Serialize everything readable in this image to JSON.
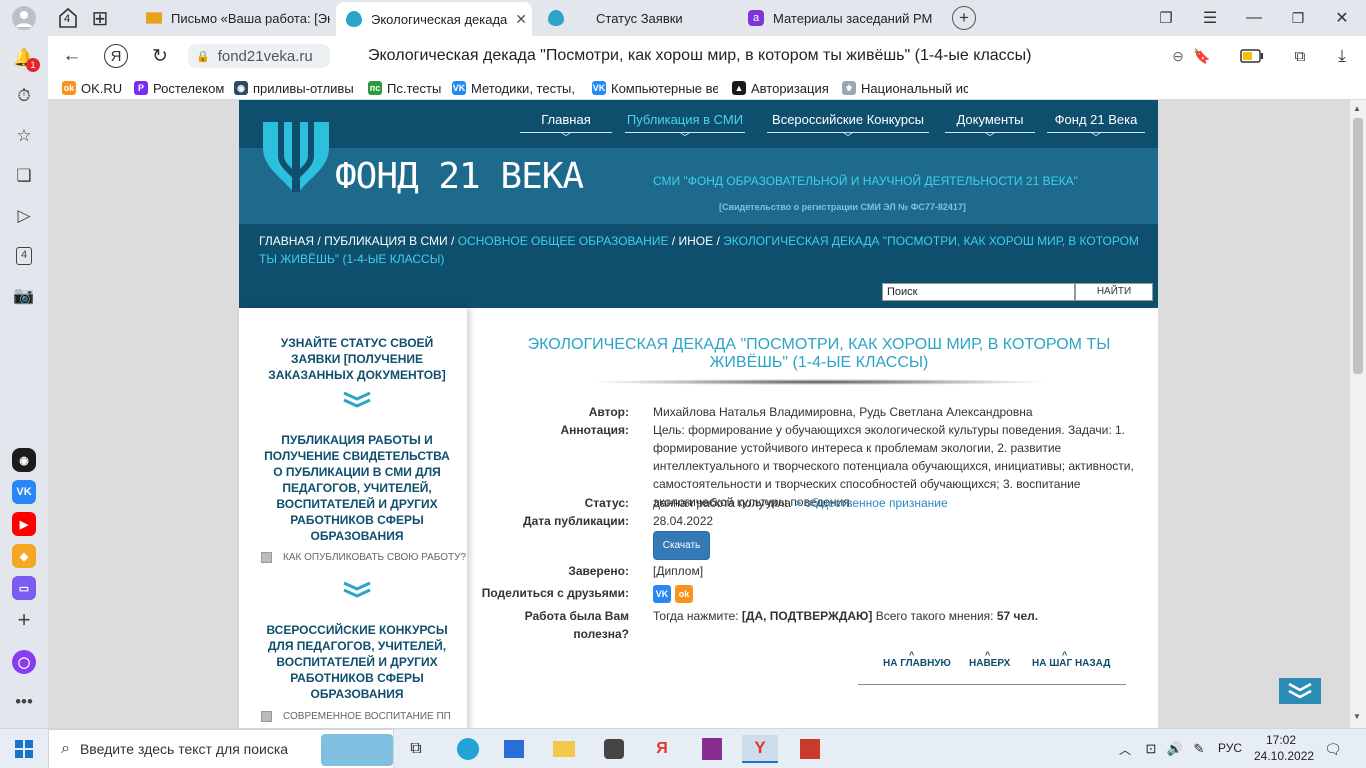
{
  "browser": {
    "tabs": [
      {
        "title": "Письмо «Ваша работа: [Эк"
      },
      {
        "title": "Экологическая декада",
        "active": true
      },
      {
        "title": "Статус Заявки"
      },
      {
        "title": "Материалы заседаний РМ"
      }
    ],
    "tab_counter": "4",
    "address_domain": "fond21veka.ru",
    "page_title": "Экологическая декада \"Посмотри, как хорош мир, в котором ты живёшь\" (1-4-ые классы)",
    "notification_badge": "1",
    "sidebar_counter": "4",
    "bookmarks": [
      "OK.RU",
      "Ростелеком",
      "приливы-отливы",
      "Пс.тесты",
      "Методики, тесты,",
      "Компьютерные ве",
      "Авторизация",
      "Национальный ис"
    ]
  },
  "site": {
    "nav": [
      {
        "label": "Главная"
      },
      {
        "label": "Публикация в СМИ",
        "current": true
      },
      {
        "label": "Всероссийские Конкурсы"
      },
      {
        "label": "Документы"
      },
      {
        "label": "Фонд 21 Века"
      }
    ],
    "logo_text": "ФОНД 21 ВЕКА",
    "smi_title": "СМИ \"ФОНД ОБРАЗОВАТЕЛЬНОЙ И НАУЧНОЙ ДЕЯТЕЛЬНОСТИ 21 ВЕКА\"",
    "certificate": "[Свидетельство о  регистрации СМИ  ЭЛ  № ФС77-82417]",
    "breadcrumbs": {
      "home": "ГЛАВНАЯ",
      "sep": " / ",
      "publication": "ПУБЛИКАЦИЯ В СМИ",
      "basic": "ОСНОВНОЕ ОБЩЕЕ ОБРАЗОВАНИЕ",
      "other": "ИНОЕ",
      "current": "ЭКОЛОГИЧЕСКАЯ ДЕКАДА \"ПОСМОТРИ, КАК ХОРОШ МИР, В КОТОРОМ ТЫ ЖИВЁШЬ\" (1-4-ЫЕ КЛАССЫ)"
    },
    "search_placeholder": "Поиск",
    "search_button": "НАЙТИ",
    "left": {
      "block1": "УЗНАЙТЕ СТАТУС СВОЕЙ ЗАЯВКИ [ПОЛУЧЕНИЕ ЗАКАЗАННЫХ ДОКУМЕНТОВ]",
      "block2": "ПУБЛИКАЦИЯ РАБОТЫ И ПОЛУЧЕНИЕ СВИДЕТЕЛЬСТВА О ПУБЛИКАЦИИ В СМИ ДЛЯ ПЕДАГОГОВ, УЧИТЕЛЕЙ, ВОСПИТАТЕЛЕЙ И ДРУГИХ РАБОТНИКОВ СФЕРЫ ОБРАЗОВАНИЯ",
      "block2_link": "КАК ОПУБЛИКОВАТЬ СВОЮ РАБОТУ?",
      "block3": "ВСЕРОССИЙСКИЕ КОНКУРСЫ ДЛЯ ПЕДАГОГОВ, УЧИТЕЛЕЙ, ВОСПИТАТЕЛЕЙ И ДРУГИХ РАБОТНИКОВ СФЕРЫ ОБРАЗОВАНИЯ",
      "block3_link": "СОВРЕМЕННОЕ ВОСПИТАНИЕ ПП"
    },
    "article": {
      "title": "ЭКОЛОГИЧЕСКАЯ ДЕКАДА \"ПОСМОТРИ, КАК ХОРОШ МИР, В КОТОРОМ ТЫ ЖИВЁШЬ\" (1-4-ЫЕ КЛАССЫ)",
      "author_label": "Автор:",
      "author": "Михайлова Наталья Владимировна, Рудь Светлана Александровна",
      "annotation_label": "Аннотация:",
      "annotation": "Цель: формирование у обучающихся экологической культуры поведения. Задачи: 1. формирование устойчивого интереса к проблемам экологии, 2. развитие интеллектуального и творческого потенциала обучающихся, инициативы; активности, самостоятельности и творческих способностей обучающихся; 3. воспитание экологической культуры поведения.",
      "status_label": "Статус:",
      "status_text": "данная работа получила ",
      "status_link": "> общественное признание",
      "date_label": "Дата публикации:",
      "date": "28.04.2022",
      "scan_button": "Скачать",
      "certified_label": "Заверено:",
      "certified": "[Диплом]",
      "share_label": "Поделиться с друзьями:",
      "useful_label": "Работа была Вам полезна?",
      "useful_text": "Тогда нажмите: ",
      "useful_confirm": "[ДА, ПОДТВЕРЖДАЮ]",
      "useful_count_text": " Всего такого мнения: ",
      "useful_count": "57 чел."
    },
    "bottom_nav": [
      "НА ГЛАВНУЮ",
      "НАВЕРХ",
      "НА ШАГ НАЗАД"
    ]
  },
  "taskbar": {
    "search_placeholder": "Введите здесь текст для поиска",
    "lang": "РУС",
    "time": "17:02",
    "date": "24.10.2022"
  }
}
